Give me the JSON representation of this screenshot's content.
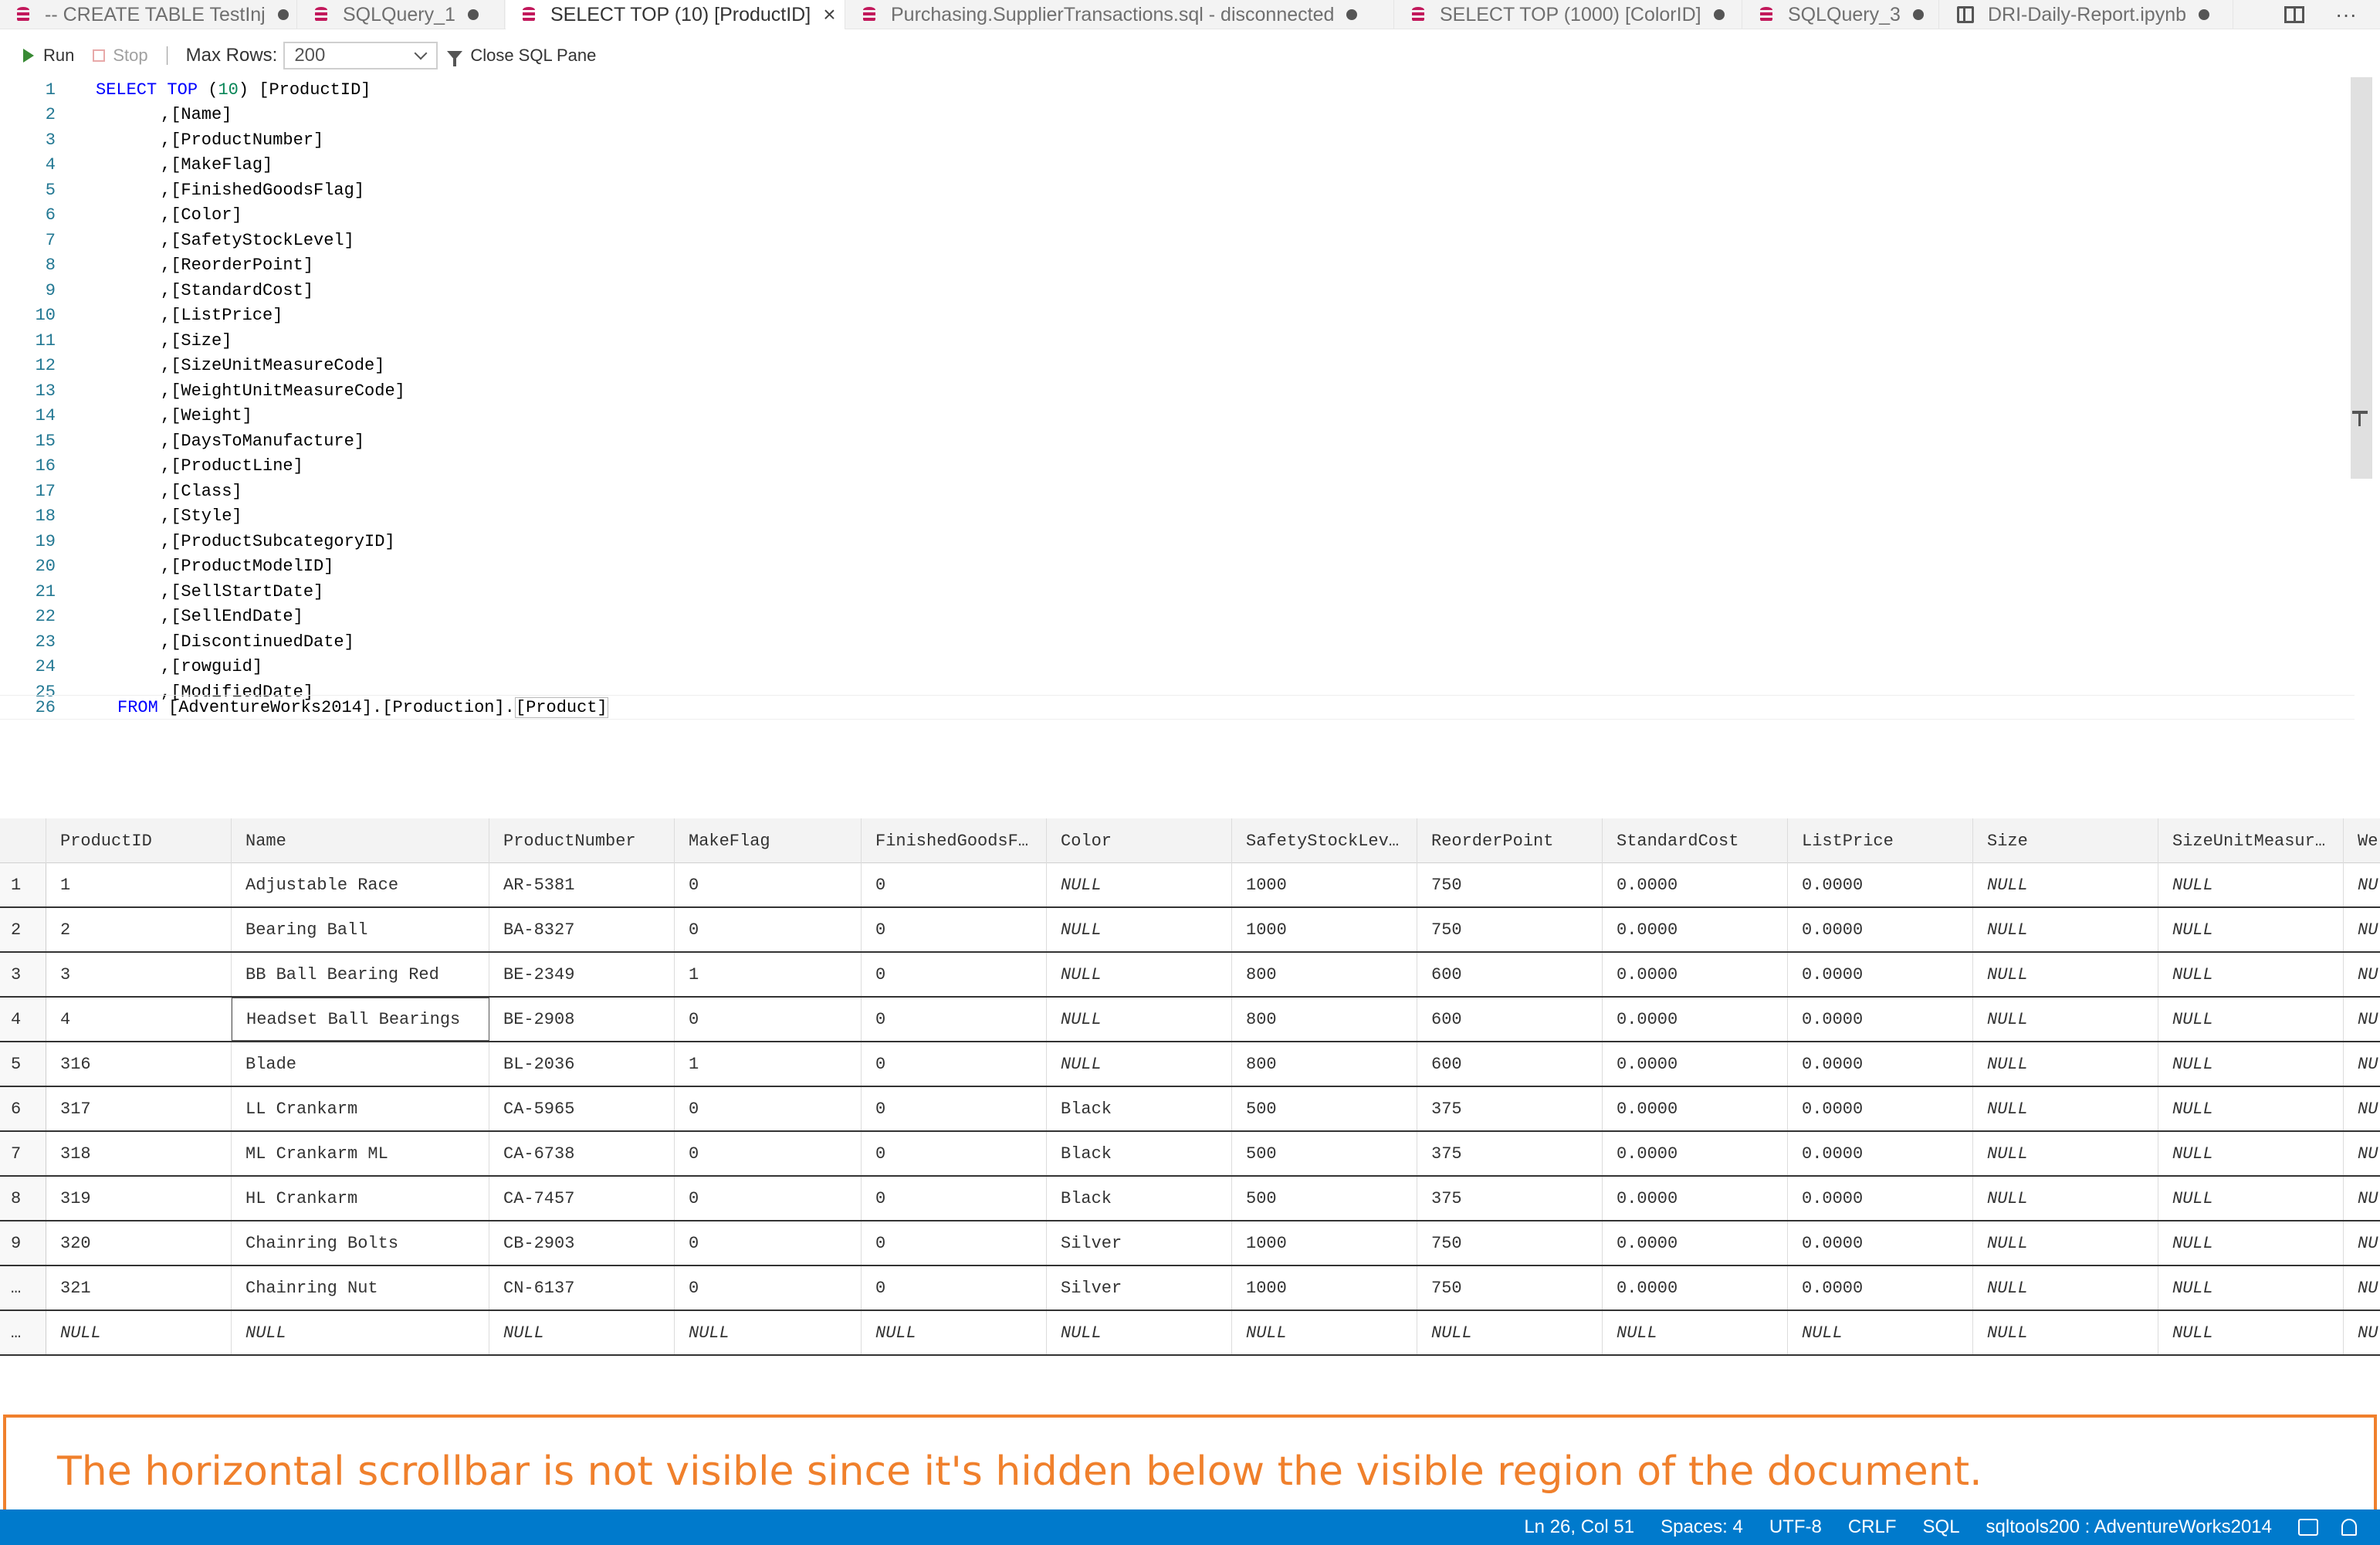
{
  "tabs": [
    {
      "label": "-- CREATE TABLE TestInj",
      "icon": "database-icon",
      "state": "modified"
    },
    {
      "label": "SQLQuery_1",
      "icon": "database-icon",
      "state": "modified"
    },
    {
      "label": "SELECT TOP (10) [ProductID]",
      "icon": "database-icon",
      "state": "active"
    },
    {
      "label": "Purchasing.SupplierTransactions.sql - disconnected",
      "icon": "database-icon",
      "state": "modified"
    },
    {
      "label": "SELECT TOP (1000) [ColorID]",
      "icon": "database-icon",
      "state": "modified"
    },
    {
      "label": "SQLQuery_3",
      "icon": "database-icon",
      "state": "modified"
    },
    {
      "label": "DRI-Daily-Report.ipynb",
      "icon": "notebook-icon",
      "state": "modified"
    }
  ],
  "tabbar_actions": {
    "more": "···"
  },
  "toolbar": {
    "run": "Run",
    "stop": "Stop",
    "max_rows_label": "Max Rows:",
    "max_rows_value": "200",
    "close_sql_pane": "Close SQL Pane"
  },
  "editor": {
    "lines": [
      {
        "n": "1",
        "kw": "SELECT TOP",
        "mid": " (",
        "num": "10",
        "rest": ") [ProductID]",
        "indent": ""
      },
      {
        "n": "2",
        "text": ",[Name]"
      },
      {
        "n": "3",
        "text": ",[ProductNumber]"
      },
      {
        "n": "4",
        "text": ",[MakeFlag]"
      },
      {
        "n": "5",
        "text": ",[FinishedGoodsFlag]"
      },
      {
        "n": "6",
        "text": ",[Color]"
      },
      {
        "n": "7",
        "text": ",[SafetyStockLevel]"
      },
      {
        "n": "8",
        "text": ",[ReorderPoint]"
      },
      {
        "n": "9",
        "text": ",[StandardCost]"
      },
      {
        "n": "10",
        "text": ",[ListPrice]"
      },
      {
        "n": "11",
        "text": ",[Size]"
      },
      {
        "n": "12",
        "text": ",[SizeUnitMeasureCode]"
      },
      {
        "n": "13",
        "text": ",[WeightUnitMeasureCode]"
      },
      {
        "n": "14",
        "text": ",[Weight]"
      },
      {
        "n": "15",
        "text": ",[DaysToManufacture]"
      },
      {
        "n": "16",
        "text": ",[ProductLine]"
      },
      {
        "n": "17",
        "text": ",[Class]"
      },
      {
        "n": "18",
        "text": ",[Style]"
      },
      {
        "n": "19",
        "text": ",[ProductSubcategoryID]"
      },
      {
        "n": "20",
        "text": ",[ProductModelID]"
      },
      {
        "n": "21",
        "text": ",[SellStartDate]"
      },
      {
        "n": "22",
        "text": ",[SellEndDate]"
      },
      {
        "n": "23",
        "text": ",[DiscontinuedDate]"
      },
      {
        "n": "24",
        "text": ",[rowguid]"
      },
      {
        "n": "25",
        "text": ",[ModifiedDate]"
      }
    ],
    "last_line": {
      "n": "26",
      "kw": "FROM",
      "text": " [AdventureWorks2014].[Production].",
      "bracket": "[Product]"
    }
  },
  "results": {
    "columns": [
      "ProductID",
      "Name",
      "ProductNumber",
      "MakeFlag",
      "FinishedGoodsF…",
      "Color",
      "SafetyStockLev…",
      "ReorderPoint",
      "StandardCost",
      "ListPrice",
      "Size",
      "SizeUnitMeasur…",
      "We"
    ],
    "rows": [
      {
        "num": "1",
        "cells": [
          "1",
          "Adjustable Race",
          "AR-5381",
          "0",
          "0",
          "NULL",
          "1000",
          "750",
          "0.0000",
          "0.0000",
          "NULL",
          "NULL",
          "NU"
        ]
      },
      {
        "num": "2",
        "cells": [
          "2",
          "Bearing Ball",
          "BA-8327",
          "0",
          "0",
          "NULL",
          "1000",
          "750",
          "0.0000",
          "0.0000",
          "NULL",
          "NULL",
          "NU"
        ]
      },
      {
        "num": "3",
        "cells": [
          "3",
          "BB Ball Bearing Red",
          "BE-2349",
          "1",
          "0",
          "NULL",
          "800",
          "600",
          "0.0000",
          "0.0000",
          "NULL",
          "NULL",
          "NU"
        ]
      },
      {
        "num": "4",
        "cells": [
          "4",
          "Headset Ball Bearings",
          "BE-2908",
          "0",
          "0",
          "NULL",
          "800",
          "600",
          "0.0000",
          "0.0000",
          "NULL",
          "NULL",
          "NU"
        ]
      },
      {
        "num": "5",
        "cells": [
          "316",
          "Blade",
          "BL-2036",
          "1",
          "0",
          "NULL",
          "800",
          "600",
          "0.0000",
          "0.0000",
          "NULL",
          "NULL",
          "NU"
        ]
      },
      {
        "num": "6",
        "cells": [
          "317",
          "LL Crankarm",
          "CA-5965",
          "0",
          "0",
          "Black",
          "500",
          "375",
          "0.0000",
          "0.0000",
          "NULL",
          "NULL",
          "NU"
        ]
      },
      {
        "num": "7",
        "cells": [
          "318",
          "ML Crankarm ML",
          "CA-6738",
          "0",
          "0",
          "Black",
          "500",
          "375",
          "0.0000",
          "0.0000",
          "NULL",
          "NULL",
          "NU"
        ]
      },
      {
        "num": "8",
        "cells": [
          "319",
          "HL Crankarm",
          "CA-7457",
          "0",
          "0",
          "Black",
          "500",
          "375",
          "0.0000",
          "0.0000",
          "NULL",
          "NULL",
          "NU"
        ]
      },
      {
        "num": "9",
        "cells": [
          "320",
          "Chainring Bolts",
          "CB-2903",
          "0",
          "0",
          "Silver",
          "1000",
          "750",
          "0.0000",
          "0.0000",
          "NULL",
          "NULL",
          "NU"
        ]
      },
      {
        "num": "…",
        "cells": [
          "321",
          "Chainring Nut",
          "CN-6137",
          "0",
          "0",
          "Silver",
          "1000",
          "750",
          "0.0000",
          "0.0000",
          "NULL",
          "NULL",
          "NU"
        ]
      },
      {
        "num": "…",
        "cells": [
          "NULL",
          "NULL",
          "NULL",
          "NULL",
          "NULL",
          "NULL",
          "NULL",
          "NULL",
          "NULL",
          "NULL",
          "NULL",
          "NULL",
          "NU"
        ]
      }
    ]
  },
  "annotation": "The horizontal scrollbar is not visible since it's hidden below the visible region of the document.",
  "statusbar": {
    "position": "Ln 26, Col 51",
    "spaces": "Spaces: 4",
    "encoding": "UTF-8",
    "eol": "CRLF",
    "language": "SQL",
    "connection": "sqltools200 : AdventureWorks2014"
  },
  "colors": {
    "accent": "#007acc",
    "annotation": "#f0802c",
    "keyword": "#0000ff",
    "line_number": "#237893",
    "number": "#098658",
    "run": "#388a34",
    "tab_icon": "#c2185b"
  }
}
